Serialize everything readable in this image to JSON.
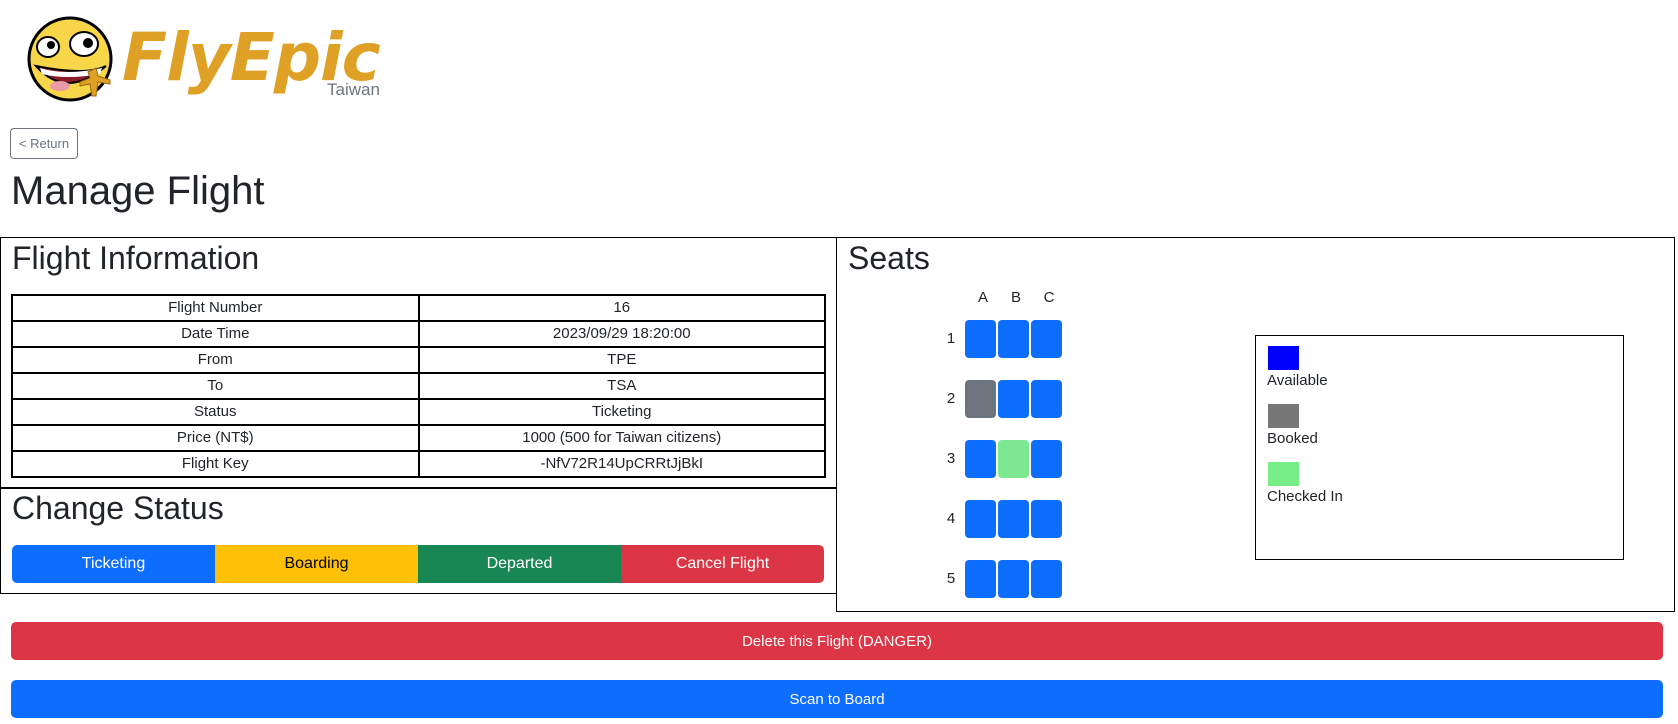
{
  "brand": {
    "name": "FlyEpic",
    "region": "Taiwan",
    "logo_icon": "trollface-airplane-logo",
    "color": "#dea025"
  },
  "nav": {
    "return_label": "< Return"
  },
  "page": {
    "title": "Manage Flight"
  },
  "flight_info": {
    "title": "Flight Information",
    "rows": [
      {
        "label": "Flight Number",
        "value": "16"
      },
      {
        "label": "Date Time",
        "value": "2023/09/29 18:20:00"
      },
      {
        "label": "From",
        "value": "TPE"
      },
      {
        "label": "To",
        "value": "TSA"
      },
      {
        "label": "Status",
        "value": "Ticketing"
      },
      {
        "label": "Price (NT$)",
        "value": "1000 (500 for Taiwan citizens)"
      },
      {
        "label": "Flight Key",
        "value": "-NfV72R14UpCRRtJjBkI"
      }
    ]
  },
  "change_status": {
    "title": "Change Status",
    "buttons": [
      "Ticketing",
      "Boarding",
      "Departed",
      "Cancel Flight"
    ],
    "colors": {
      "ticketing": "#0d6efd",
      "boarding": "#ffc107",
      "departed": "#198754",
      "cancel": "#dc3545"
    }
  },
  "seats": {
    "title": "Seats",
    "columns": [
      "A",
      "B",
      "C"
    ],
    "rows": [
      {
        "number": "1",
        "seats": [
          "available",
          "available",
          "available"
        ]
      },
      {
        "number": "2",
        "seats": [
          "booked",
          "available",
          "available"
        ]
      },
      {
        "number": "3",
        "seats": [
          "available",
          "checked_in",
          "available"
        ]
      },
      {
        "number": "4",
        "seats": [
          "available",
          "available",
          "available"
        ]
      },
      {
        "number": "5",
        "seats": [
          "available",
          "available",
          "available"
        ]
      }
    ],
    "colors": {
      "available": "#0d6efd",
      "booked": "#6c757d",
      "checked_in": "#7ce88f"
    }
  },
  "legend": {
    "items": [
      {
        "label": "Available",
        "color": "#0000ff"
      },
      {
        "label": "Booked",
        "color": "#777777"
      },
      {
        "label": "Checked In",
        "color": "#77ee88"
      }
    ]
  },
  "actions": {
    "delete_label": "Delete this Flight (DANGER)",
    "scan_label": "Scan to Board"
  }
}
